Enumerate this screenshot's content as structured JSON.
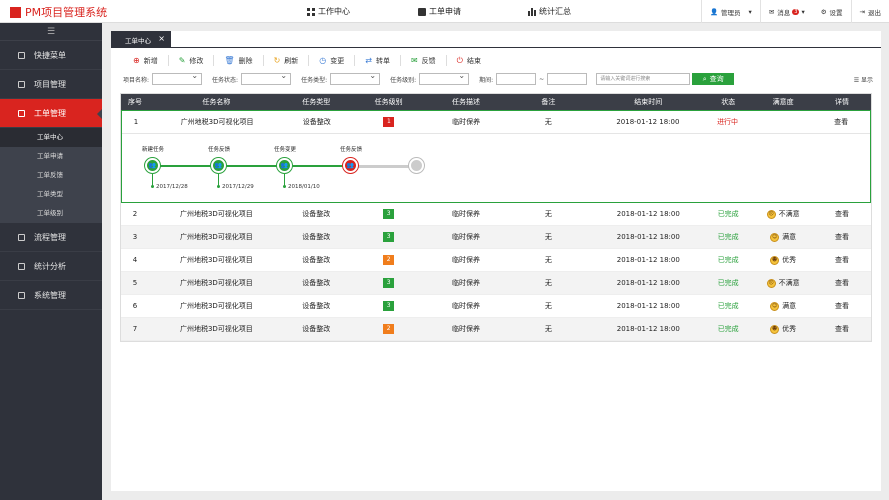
{
  "app": {
    "title": "PM项目管理系统"
  },
  "topnav": {
    "work_center": "工作中心",
    "work_order_apply": "工单申请",
    "stats": "统计汇总"
  },
  "topright": {
    "user": "管理员",
    "messages": "消息",
    "msg_count": "3",
    "settings": "设置",
    "logout": "退出"
  },
  "sidebar": {
    "toggle": "☰",
    "items": [
      {
        "label": "快捷菜单"
      },
      {
        "label": "项目管理"
      },
      {
        "label": "工单管理"
      },
      {
        "label": "流程管理"
      },
      {
        "label": "统计分析"
      },
      {
        "label": "系统管理"
      }
    ],
    "subitems": [
      {
        "label": "工单中心"
      },
      {
        "label": "工单申请"
      },
      {
        "label": "工单反馈"
      },
      {
        "label": "工单类型"
      },
      {
        "label": "工单级别"
      }
    ]
  },
  "tab": {
    "label": "工单中心",
    "close": "×"
  },
  "toolbar": [
    {
      "label": "新增",
      "icon": "⊕",
      "color": "#d9241f"
    },
    {
      "label": "修改",
      "icon": "✎",
      "color": "#2aa13c"
    },
    {
      "label": "删除",
      "icon": "🗑",
      "color": "#3a7bd5"
    },
    {
      "label": "刷新",
      "icon": "↻",
      "color": "#e8a21c"
    },
    {
      "label": "变更",
      "icon": "◷",
      "color": "#3a7bd5"
    },
    {
      "label": "转单",
      "icon": "⇄",
      "color": "#3a7bd5"
    },
    {
      "label": "反馈",
      "icon": "✉",
      "color": "#2aa13c"
    },
    {
      "label": "结束",
      "icon": "⏻",
      "color": "#d9241f"
    }
  ],
  "filters": {
    "project_name": "项目名称:",
    "task_status": "任务状态:",
    "task_type": "任务类型:",
    "task_level": "任务级别:",
    "period": "期间:",
    "dash": "~",
    "keyword_placeholder": "请输入关键词进行搜索",
    "query": "查询",
    "columns": "☰ 显示"
  },
  "table": {
    "headers": [
      "序号",
      "任务名称",
      "任务类型",
      "任务级别",
      "任务描述",
      "备注",
      "结束时间",
      "状态",
      "满意度",
      "详情"
    ],
    "rows": [
      {
        "no": "1",
        "name": "广州地税3D可视化项目",
        "type": "设备整改",
        "level": "1",
        "level_color": "#d9241f",
        "desc": "临时保养",
        "remark": "无",
        "end": "2018-01-12 18:00",
        "status": "进行中",
        "status_class": "prog",
        "sat": "",
        "detail": "查看"
      },
      {
        "no": "2",
        "name": "广州地税3D可视化项目",
        "type": "设备整改",
        "level": "3",
        "level_color": "#2aa13c",
        "desc": "临时保养",
        "remark": "无",
        "end": "2018-01-12 18:00",
        "status": "已完成",
        "status_class": "done",
        "sat": "不满意",
        "face": "☹",
        "detail": "查看"
      },
      {
        "no": "3",
        "name": "广州地税3D可视化项目",
        "type": "设备整改",
        "level": "3",
        "level_color": "#2aa13c",
        "desc": "临时保养",
        "remark": "无",
        "end": "2018-01-12 18:00",
        "status": "已完成",
        "status_class": "done",
        "sat": "满意",
        "face": "☺",
        "detail": "查看"
      },
      {
        "no": "4",
        "name": "广州地税3D可视化项目",
        "type": "设备整改",
        "level": "2",
        "level_color": "#f07d1c",
        "desc": "临时保养",
        "remark": "无",
        "end": "2018-01-12 18:00",
        "status": "已完成",
        "status_class": "done",
        "sat": "优秀",
        "face": "☻",
        "detail": "查看"
      },
      {
        "no": "5",
        "name": "广州地税3D可视化项目",
        "type": "设备整改",
        "level": "3",
        "level_color": "#2aa13c",
        "desc": "临时保养",
        "remark": "无",
        "end": "2018-01-12 18:00",
        "status": "已完成",
        "status_class": "done",
        "sat": "不满意",
        "face": "☹",
        "detail": "查看"
      },
      {
        "no": "6",
        "name": "广州地税3D可视化项目",
        "type": "设备整改",
        "level": "3",
        "level_color": "#2aa13c",
        "desc": "临时保养",
        "remark": "无",
        "end": "2018-01-12 18:00",
        "status": "已完成",
        "status_class": "done",
        "sat": "满意",
        "face": "☺",
        "detail": "查看"
      },
      {
        "no": "7",
        "name": "广州地税3D可视化项目",
        "type": "设备整改",
        "level": "2",
        "level_color": "#f07d1c",
        "desc": "临时保养",
        "remark": "无",
        "end": "2018-01-12 18:00",
        "status": "已完成",
        "status_class": "done",
        "sat": "优秀",
        "face": "☻",
        "detail": "查看"
      }
    ]
  },
  "timeline": [
    {
      "label": "新建任务",
      "date": "2017/12/28",
      "state": "done"
    },
    {
      "label": "任务反馈",
      "date": "2017/12/29",
      "state": "done"
    },
    {
      "label": "任务变更",
      "date": "2018/01/10",
      "state": "done"
    },
    {
      "label": "任务反馈",
      "date": "",
      "state": "current"
    },
    {
      "label": "",
      "date": "",
      "state": "pending"
    }
  ]
}
